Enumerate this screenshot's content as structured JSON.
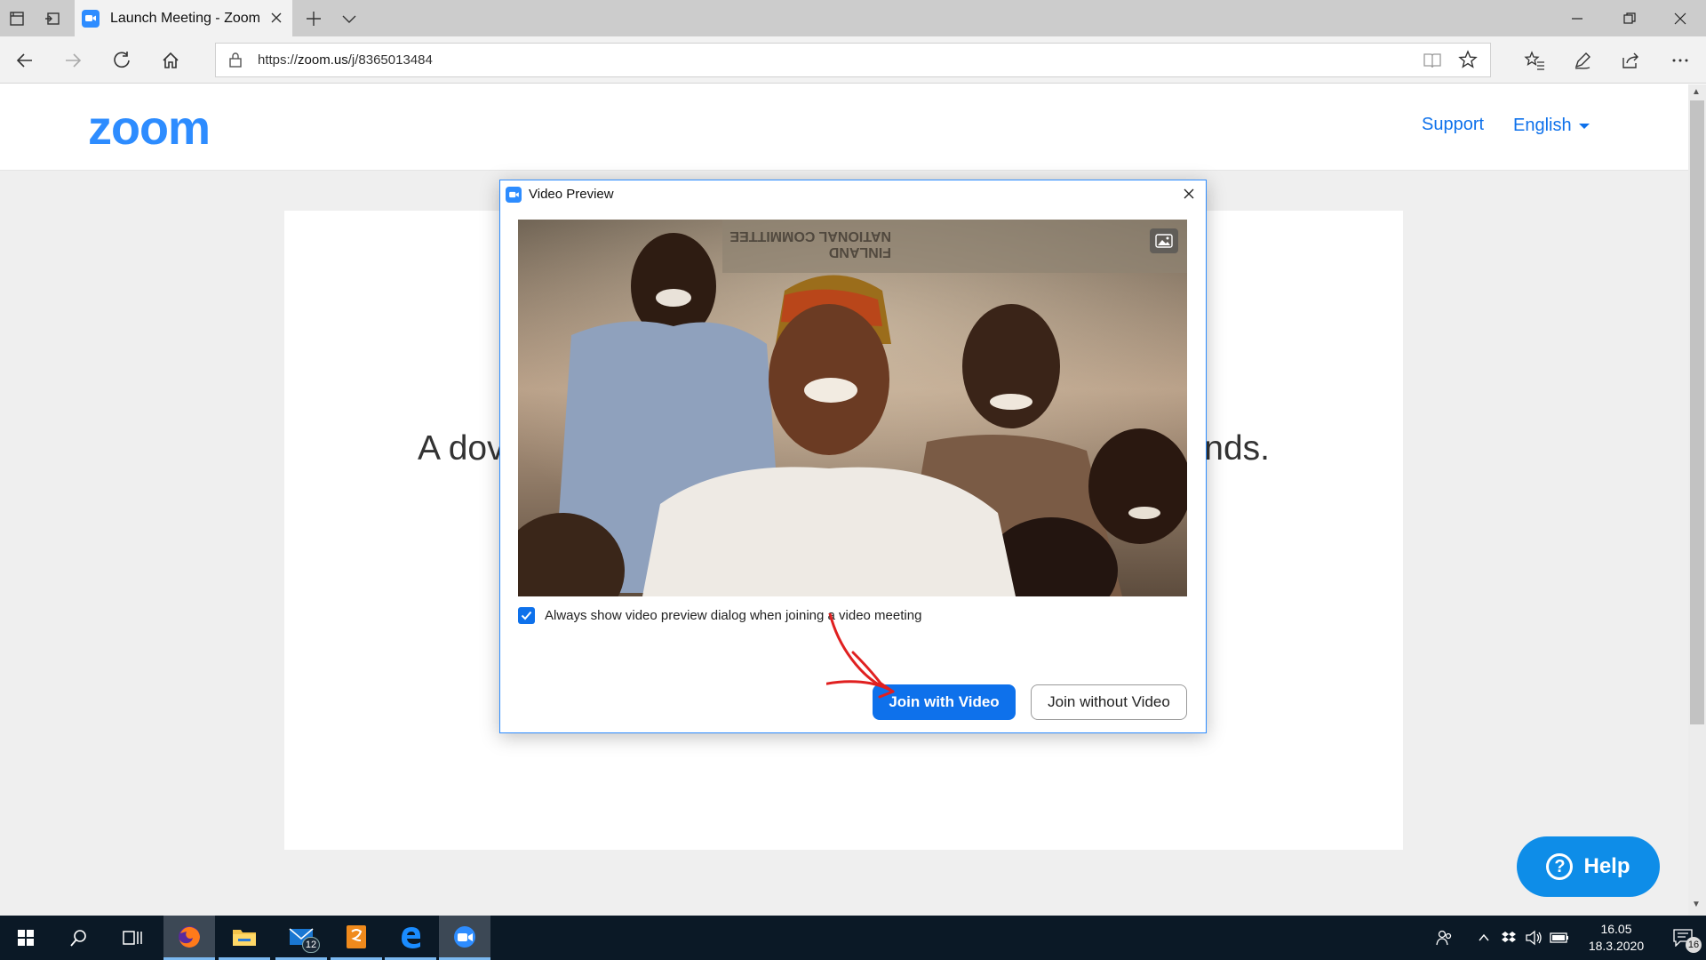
{
  "browser": {
    "tab_title": "Launch Meeting - Zoom",
    "address": {
      "protocol": "https://",
      "host": "zoom.us",
      "path": "/j/8365013484"
    }
  },
  "site": {
    "logo": "zoom",
    "nav": {
      "support": "Support",
      "language": "English"
    },
    "card": {
      "text_left": "A dov",
      "text_right": "nds."
    },
    "help_label": "Help"
  },
  "dialog": {
    "title": "Video Preview",
    "checkbox_label": "Always show video preview dialog when joining a video meeting",
    "checkbox_checked": true,
    "join_with_video": "Join with Video",
    "join_without_video": "Join without Video",
    "camera_feed_text": [
      "NATIONAL COMMITTEE",
      "FINLAND"
    ]
  },
  "taskbar": {
    "mail_badge": "12",
    "clock_time": "16.05",
    "clock_date": "18.3.2020",
    "notification_count": "16"
  },
  "colors": {
    "brand": "#2d8cff",
    "primary_button": "#0e71eb",
    "annotation_arrow": "#e02020",
    "taskbar": "#0b1926"
  },
  "icons": [
    "tab-actions-icon",
    "set-aside-icon",
    "zoom-icon",
    "close-icon",
    "plus-icon",
    "chevron-down-icon",
    "minimize-icon",
    "restore-icon",
    "back-icon",
    "forward-icon",
    "refresh-icon",
    "home-icon",
    "lock-icon",
    "reading-view-icon",
    "star-icon",
    "favorites-icon",
    "pen-icon",
    "share-icon",
    "more-icon",
    "background-icon",
    "check-icon",
    "windows-icon",
    "search-icon",
    "task-view-icon",
    "firefox-icon",
    "file-explorer-icon",
    "mail-icon",
    "pdf-icon",
    "edge-icon",
    "people-icon",
    "volume-icon",
    "battery-icon",
    "dropbox-icon",
    "notification-icon"
  ]
}
